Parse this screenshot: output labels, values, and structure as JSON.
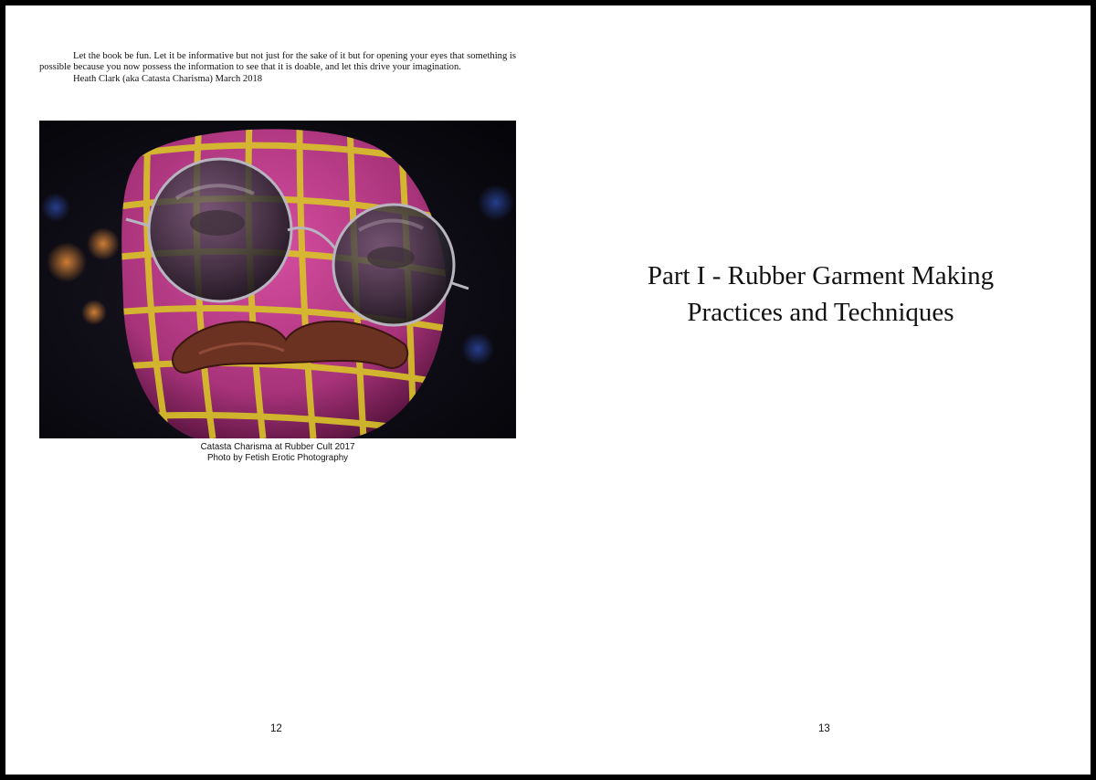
{
  "left_page": {
    "paragraphs": [
      "Let the book be fun. Let it be informative but not just for the sake of it but for opening your eyes that something is possible because you now possess the information to see that it is doable, and let this drive your imagination.",
      "Heath Clark (aka Catasta Charisma) March 2018"
    ],
    "caption": {
      "line1": "Catasta Charisma at Rubber Cult 2017",
      "line2": "Photo by Fetish Erotic Photography"
    },
    "page_number": "12"
  },
  "right_page": {
    "title_line1": "Part I - Rubber Garment Making",
    "title_line2": "Practices and Techniques",
    "page_number": "13"
  },
  "colors": {
    "page_background": "#ffffff",
    "border": "#000000",
    "mask_pink": "#c2408e",
    "mask_yellow": "#d9c428",
    "mustache_brown": "#6b3222"
  }
}
